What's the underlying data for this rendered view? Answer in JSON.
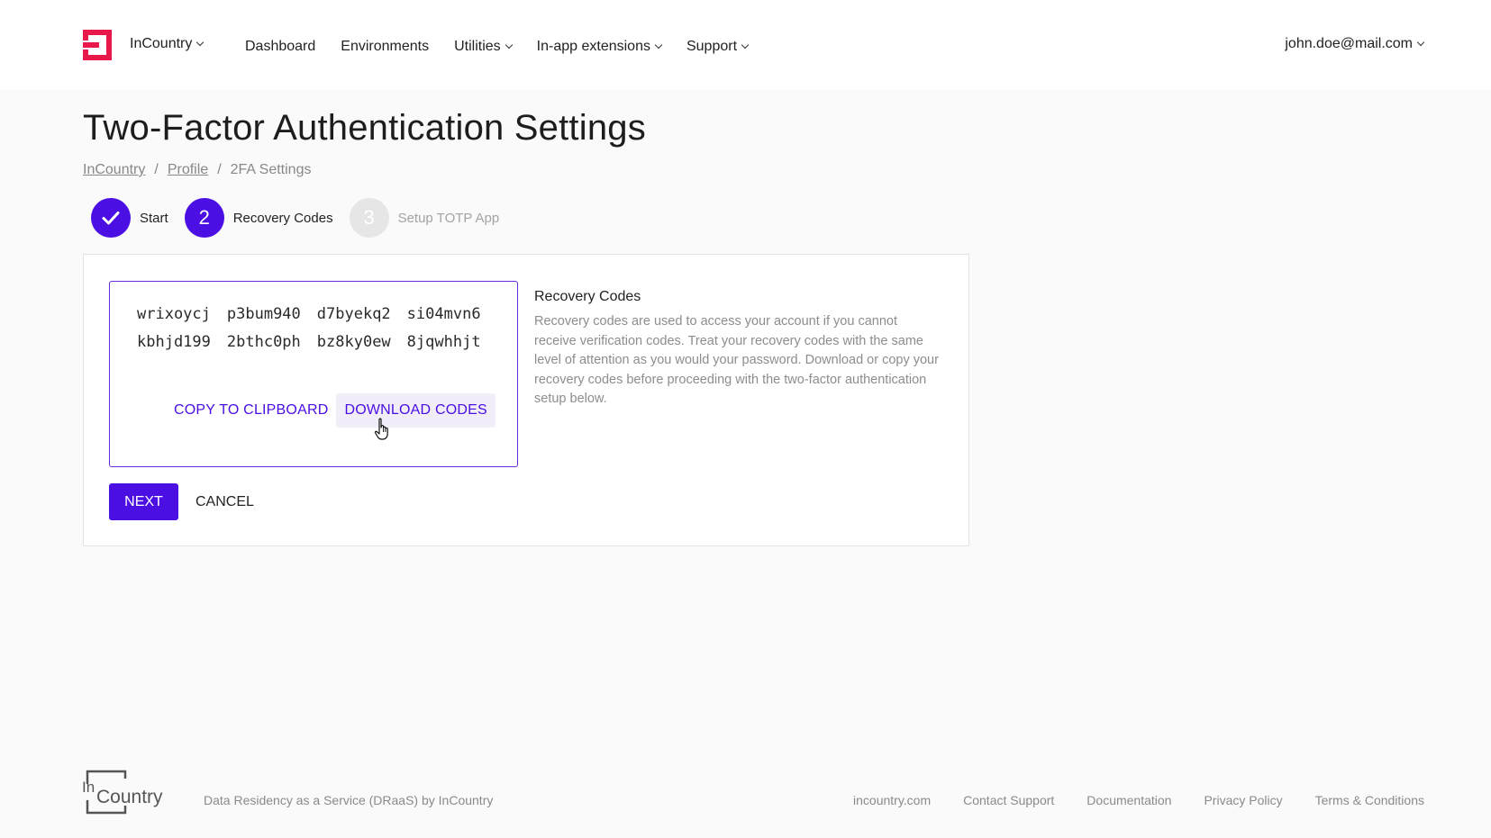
{
  "header": {
    "brand_label": "InCountry",
    "nav": [
      {
        "label": "Dashboard"
      },
      {
        "label": "Environments"
      },
      {
        "label": "Utilities"
      },
      {
        "label": "In-app extensions"
      },
      {
        "label": "Support"
      }
    ],
    "user": "john.doe@mail.com"
  },
  "page": {
    "title": "Two-Factor Authentication Settings",
    "breadcrumb": [
      "InCountry",
      "Profile",
      "2FA Settings"
    ]
  },
  "stepper": {
    "steps": [
      {
        "label": "Start",
        "number": "",
        "status": "done"
      },
      {
        "label": "Recovery Codes",
        "number": "2",
        "status": "active"
      },
      {
        "label": "Setup TOTP App",
        "number": "3",
        "status": "pending"
      }
    ]
  },
  "codes": {
    "items": [
      "wrixoycj",
      "p3bum940",
      "d7byekq2",
      "si04mvn6",
      "kbhjd199",
      "2bthc0ph",
      "bz8ky0ew",
      "8jqwhhjt"
    ],
    "copy_label": "COPY TO CLIPBOARD",
    "download_label": "DOWNLOAD CODES"
  },
  "info": {
    "title": "Recovery Codes",
    "text": "Recovery codes are used to access your account if you cannot receive verification codes. Treat your recovery codes with the same level of attention as you would your password. Download or copy your recovery codes before proceeding with the two-factor authentication setup below."
  },
  "actions": {
    "next_label": "NEXT",
    "cancel_label": "CANCEL"
  },
  "footer": {
    "logo_text_in": "In",
    "logo_text_country": "Country",
    "tagline": "Data Residency as a Service (DRaaS) by InCountry",
    "links": [
      "incountry.com",
      "Contact Support",
      "Documentation",
      "Privacy Policy",
      "Terms & Conditions"
    ]
  },
  "colors": {
    "accent": "#4b0fe3",
    "brand_red": "#e8194a"
  },
  "icons": {
    "logo": "incountry-logo-icon",
    "check": "check-icon",
    "cursor": "hand-pointer-icon"
  }
}
